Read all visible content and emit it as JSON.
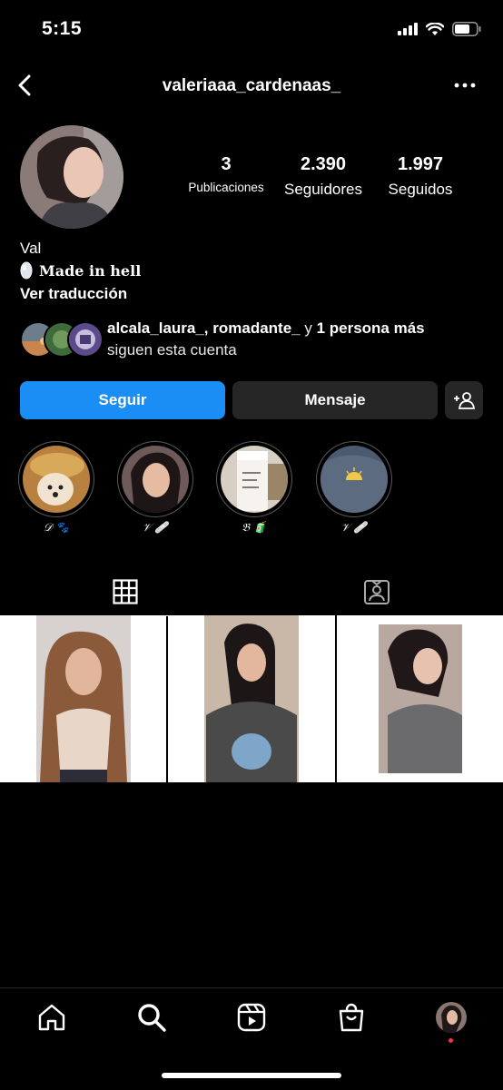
{
  "status_bar": {
    "time": "5:15"
  },
  "header": {
    "username": "valeriaaa_cardenaas_"
  },
  "profile": {
    "stats": [
      {
        "value": "3",
        "label": "Publicaciones"
      },
      {
        "value": "2.390",
        "label": "Seguidores"
      },
      {
        "value": "1.997",
        "label": "Seguidos"
      }
    ],
    "name": "Val",
    "bio": "Made in hell",
    "translate_label": "Ver traducción",
    "followed_by": {
      "users": "alcala_laura_, romadante_",
      "connector": " y ",
      "more": "1 persona más",
      "suffix": "siguen esta cuenta"
    }
  },
  "actions": {
    "follow": "Seguir",
    "message": "Mensaje"
  },
  "highlights": [
    {
      "label": "𝒟 🐾"
    },
    {
      "label": "𝒱 🩹"
    },
    {
      "label": "𝔅 🧃"
    },
    {
      "label": "𝒱 🩹"
    }
  ],
  "colors": {
    "accent": "#1a8ef5",
    "secondary_button": "#262626",
    "background": "#000000",
    "notification_dot": "#ff3040"
  }
}
